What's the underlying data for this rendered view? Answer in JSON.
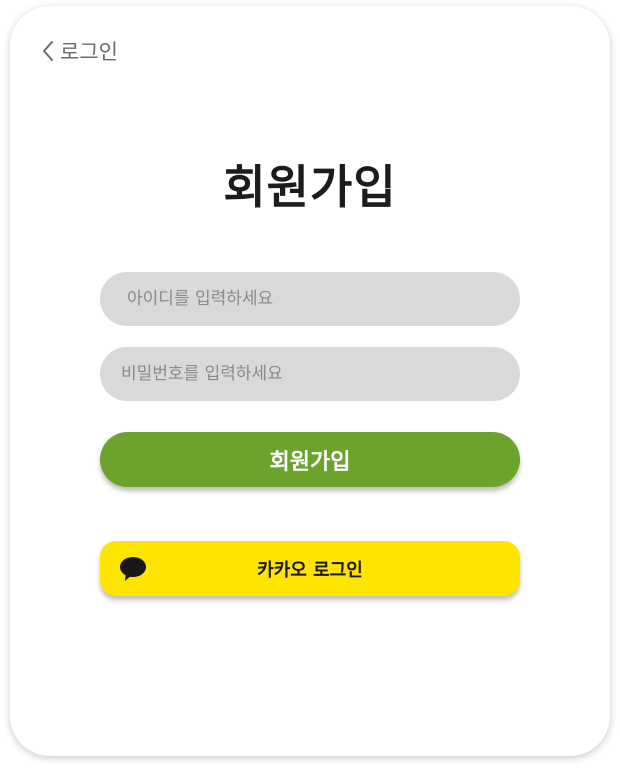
{
  "nav": {
    "back_label": "로그인"
  },
  "page": {
    "title": "회원가입"
  },
  "form": {
    "id_placeholder": "아이디를 입력하세요",
    "id_value": "",
    "password_placeholder": "비밀번호를 입력하세요",
    "password_value": "",
    "signup_label": "회원가입"
  },
  "kakao": {
    "label": "카카오 로그인",
    "icon": "speech-bubble-icon"
  },
  "colors": {
    "signup_button": "#6ba32d",
    "kakao_button": "#fee500",
    "input_background": "#d9d9d9",
    "title_text": "#1c1c1c"
  }
}
